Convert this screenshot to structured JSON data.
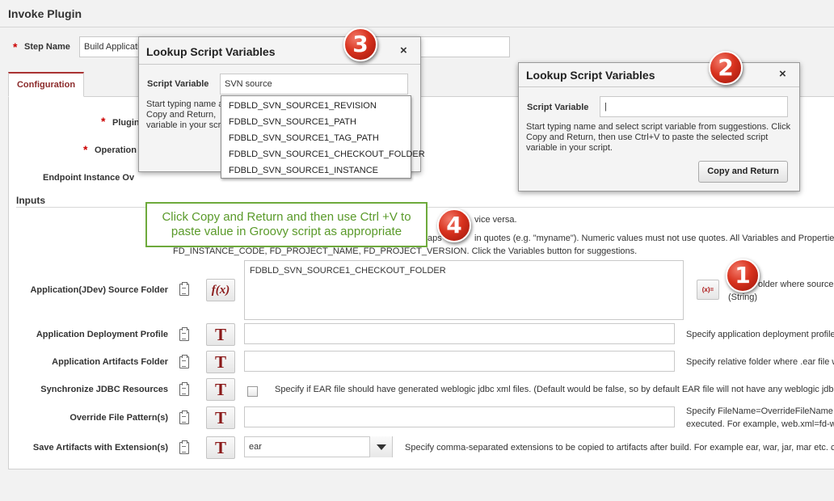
{
  "page": {
    "title": "Invoke Plugin",
    "step_name_label": "Step Name",
    "step_name_value": "Build Applicati",
    "tab_configuration": "Configuration",
    "plugin_label": "Plugin",
    "operation_label": "Operation",
    "endpoint_label": "Endpoint Instance Ov",
    "inputs_heading": "Inputs"
  },
  "info_text": {
    "line1": "vice versa.",
    "line2a": "aps",
    "line2b": "in quotes (e.g. \"myname\"). Numeric values must not use quotes. All Variables and Properties ca",
    "line3": "FD_INSTANCE_CODE, FD_PROJECT_NAME, FD_PROJECT_VERSION. Click the Variables button for suggestions."
  },
  "rows": [
    {
      "label": "Application(JDev) Source Folder",
      "value": "FDBLD_SVN_SOURCE1_CHECKOUT_FOLDER",
      "desc_a": "older where source",
      "desc_b": "(String)"
    },
    {
      "label": "Application Deployment Profile",
      "value": "",
      "desc": "Specify application deployment profile"
    },
    {
      "label": "Application Artifacts Folder",
      "value": "",
      "desc": "Specify relative folder where .ear file w"
    },
    {
      "label": "Synchronize JDBC Resources",
      "desc": "Specify if EAR file should have generated weblogic jdbc xml files. (Default would be false, so by default EAR file will not have any weblogic jdbc x"
    },
    {
      "label": "Override File Pattern(s)",
      "value": "",
      "desc_a": "Specify FileName=OverrideFileName p",
      "desc_b": "executed. For example, web.xml=fd-w"
    },
    {
      "label": "Save Artifacts with Extension(s)",
      "value": "ear",
      "desc": "Specify comma-separated extensions to be copied to artifacts after build. For example ear, war, jar, mar etc. c"
    }
  ],
  "icons": {
    "fx": "f(x)",
    "text_type": "T",
    "var": "(x)="
  },
  "dialog_left": {
    "title": "Lookup Script Variables",
    "close": "×",
    "field_label": "Script Variable",
    "field_value": "SVN source",
    "help_a": "Start typing name a",
    "help_b": "Copy and Return,",
    "help_c": "variable in your scri",
    "suggestions": [
      "FDBLD_SVN_SOURCE1_REVISION",
      "FDBLD_SVN_SOURCE1_PATH",
      "FDBLD_SVN_SOURCE1_TAG_PATH",
      "FDBLD_SVN_SOURCE1_CHECKOUT_FOLDER",
      "FDBLD_SVN_SOURCE1_INSTANCE"
    ]
  },
  "dialog_right": {
    "title": "Lookup Script Variables",
    "close": "×",
    "field_label": "Script Variable",
    "field_value": "|",
    "help_1": "Start typing name and select script variable from suggestions. Click",
    "help_2": "Copy and Return, then use Ctrl+V to paste the selected script",
    "help_3": "variable in your script.",
    "button": "Copy and Return"
  },
  "callout": {
    "line1": "Click Copy and Return and then use Ctrl +V to",
    "line2": "paste value in Groovy script as appropriate"
  },
  "badges": {
    "b1": "1",
    "b2": "2",
    "b3": "3",
    "b4": "4"
  },
  "colors": {
    "accent": "#8b2a2a",
    "callout_border": "#6eaa3c",
    "badge": "#d8321e"
  }
}
